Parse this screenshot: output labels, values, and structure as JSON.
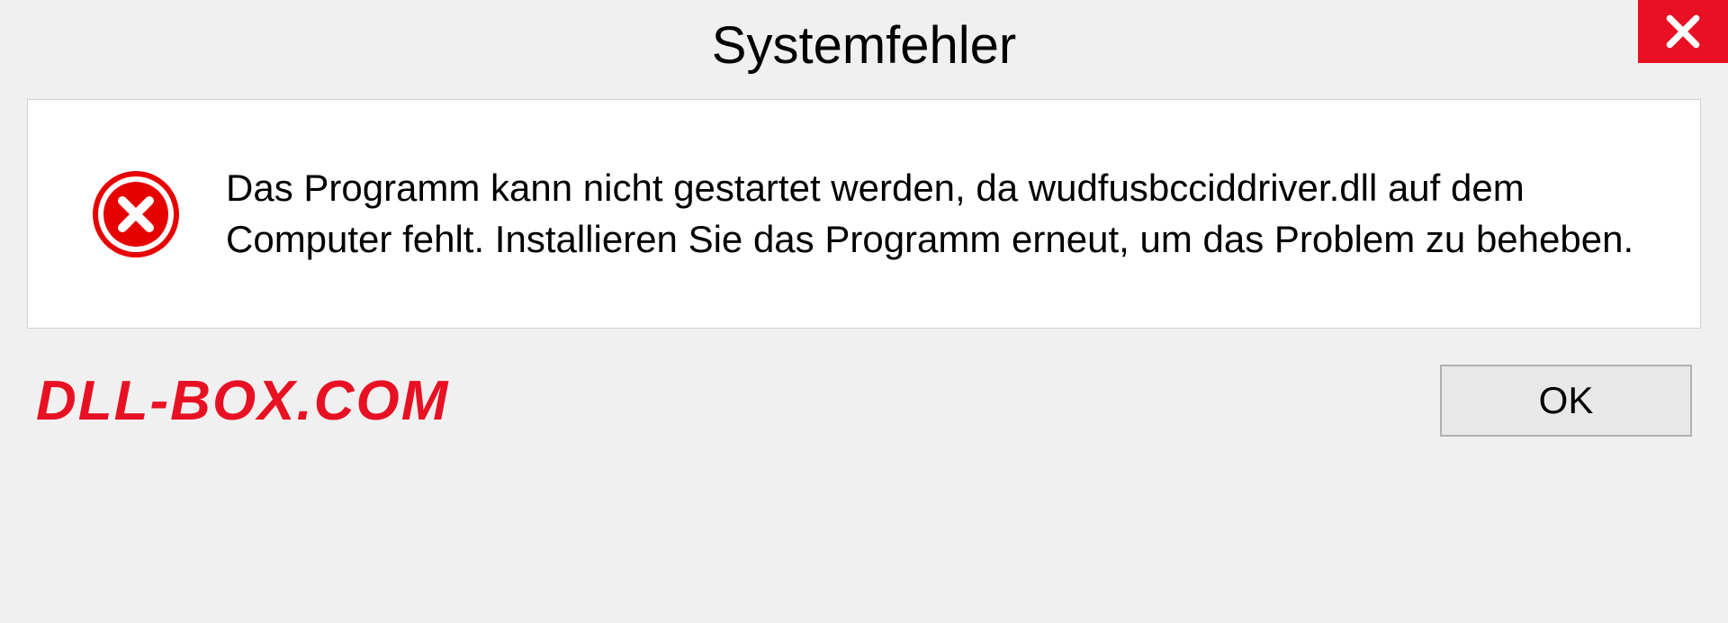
{
  "dialog": {
    "title": "Systemfehler",
    "message": "Das Programm kann nicht gestartet werden, da wudfusbcciddriver.dll auf dem Computer fehlt. Installieren Sie das Programm erneut, um das Problem zu beheben.",
    "ok_label": "OK"
  },
  "watermark": "DLL-BOX.COM",
  "icons": {
    "close": "close-icon",
    "error": "error-icon"
  },
  "colors": {
    "accent_red": "#e81123",
    "background": "#f0f0f0",
    "panel": "#ffffff"
  }
}
